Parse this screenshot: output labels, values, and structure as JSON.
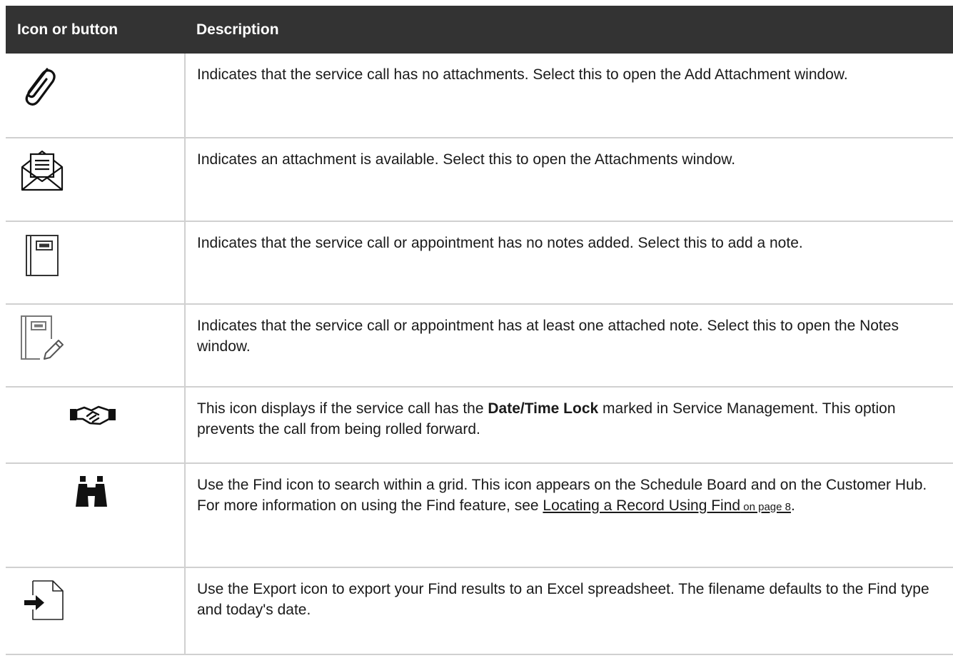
{
  "table": {
    "header": {
      "icon_col": "Icon or button",
      "desc_col": "Description"
    },
    "rows": [
      {
        "icon": "paperclip-icon",
        "description": "Indicates that the service call has no attachments. Select this to open the Add Attachment window."
      },
      {
        "icon": "envelope-attachment-icon",
        "description": "Indicates an attachment is available. Select this to open the Attachments window."
      },
      {
        "icon": "notebook-icon",
        "description": "Indicates that the service call or appointment has no notes added. Select this to add a note."
      },
      {
        "icon": "notebook-edit-icon",
        "description": "Indicates that the service call or appointment has at least one attached note. Select this to open the Notes window."
      },
      {
        "icon": "handshake-icon",
        "desc_before": "This icon displays if the service call has the ",
        "desc_bold": "Date/Time Lock",
        "desc_after": " marked in Service Management. This option prevents the call from being rolled forward."
      },
      {
        "icon": "binoculars-icon",
        "desc_before": "Use the Find icon to search within a grid. This icon appears on the Schedule Board and on the Customer Hub. For more information on using the Find feature, see ",
        "link_text": "Locating a Record Using Find",
        "link_page": " on page 8",
        "desc_after": "."
      },
      {
        "icon": "export-icon",
        "description": "Use the Export icon to export your Find results to an Excel spreadsheet. The filename defaults to the Find type and today's date."
      }
    ]
  }
}
